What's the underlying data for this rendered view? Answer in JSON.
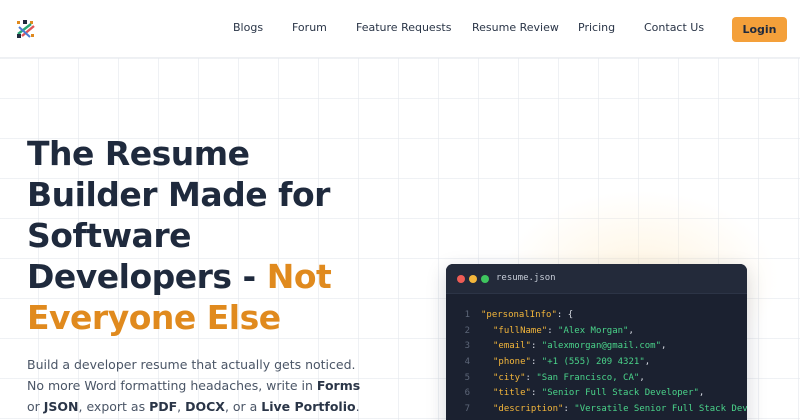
{
  "header": {
    "nav": [
      "Blogs",
      "Forum",
      "Feature Requests",
      "Resume Review",
      "Pricing",
      "Contact Us"
    ],
    "login_label": "Login"
  },
  "hero": {
    "title_dark_1": "The Resume",
    "title_dark_2": "Builder Made for",
    "title_dark_3": "Software",
    "title_dark_4": "Developers - ",
    "title_accent_1": "Not",
    "title_accent_2": "Everyone Else",
    "sub_1": "Build a developer resume that actually gets noticed.",
    "sub_2": "No more Word formatting headaches, write in ",
    "sub_forms": "Forms",
    "sub_or": "or ",
    "sub_json": "JSON",
    "sub_export": ", export as ",
    "sub_pdf": "PDF",
    "sub_comma": ", ",
    "sub_docx": "DOCX",
    "sub_ora": ", or a ",
    "sub_portfolio": "Live Portfolio",
    "sub_end": "."
  },
  "code": {
    "file_name": "resume.json",
    "lines": [
      {
        "n": "1",
        "key": "\"personalInfo\"",
        "val": "",
        "tail": ": {"
      },
      {
        "n": "2",
        "key": "\"fullName\"",
        "val": "\"Alex Morgan\"",
        "tail": ","
      },
      {
        "n": "3",
        "key": "\"email\"",
        "val": "\"alexmorgan@gmail.com\"",
        "tail": ","
      },
      {
        "n": "4",
        "key": "\"phone\"",
        "val": "\"+1 (555) 209 4321\"",
        "tail": ","
      },
      {
        "n": "5",
        "key": "\"city\"",
        "val": "\"San Francisco, CA\"",
        "tail": ","
      },
      {
        "n": "6",
        "key": "\"title\"",
        "val": "\"Senior Full Stack Developer\"",
        "tail": ","
      },
      {
        "n": "7",
        "key": "\"description\"",
        "val": "\"Versatile Senior Full Stack Developer",
        "tail": ""
      }
    ]
  },
  "colors": {
    "accent": "#e08a1e",
    "button": "#f4a03a",
    "dark": "#1f2a3d",
    "code_bg": "#1b2130"
  }
}
